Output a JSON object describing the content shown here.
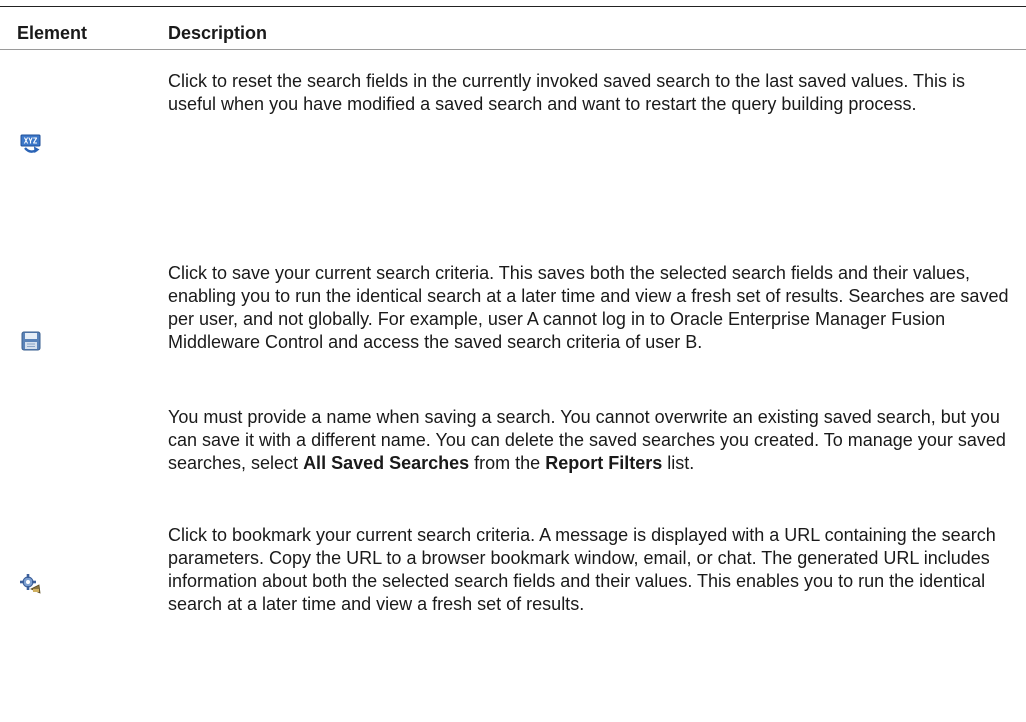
{
  "table": {
    "headers": {
      "element": "Element",
      "description": "Description"
    },
    "rows": [
      {
        "icon": "reset-search-icon",
        "paragraphs": [
          "Click to reset the search fields in the currently invoked saved search to the last saved values. This is useful when you have modified a saved search and want to restart the query building process."
        ]
      },
      {
        "icon": "save-disk-icon",
        "paragraphs": [
          "Click to save your current search criteria. This saves both the selected search fields and their values, enabling you to run the identical search at a later time and view a fresh set of results. Searches are saved per user, and not globally. For example, user A cannot log in to Oracle Enterprise Manager Fusion Middleware Control and access the saved search criteria of user B."
        ],
        "note": {
          "text_before": "You must provide a name when saving a search. You cannot overwrite an existing saved search, but you can save it with a different name. You can delete the saved searches you created. To manage your saved searches, select ",
          "bold_1": "All Saved Searches",
          "text_middle": " from the ",
          "bold_2": "Report Filters",
          "text_after": " list."
        }
      },
      {
        "icon": "bookmark-gear-icon",
        "paragraphs": [
          "Click to bookmark your current search criteria. A message is displayed with a URL containing the search parameters. Copy the URL to a browser bookmark window, email, or chat. The generated URL includes information about both the selected search fields and their values. This enables you to run the identical search at a later time and view a fresh set of results."
        ]
      }
    ]
  }
}
